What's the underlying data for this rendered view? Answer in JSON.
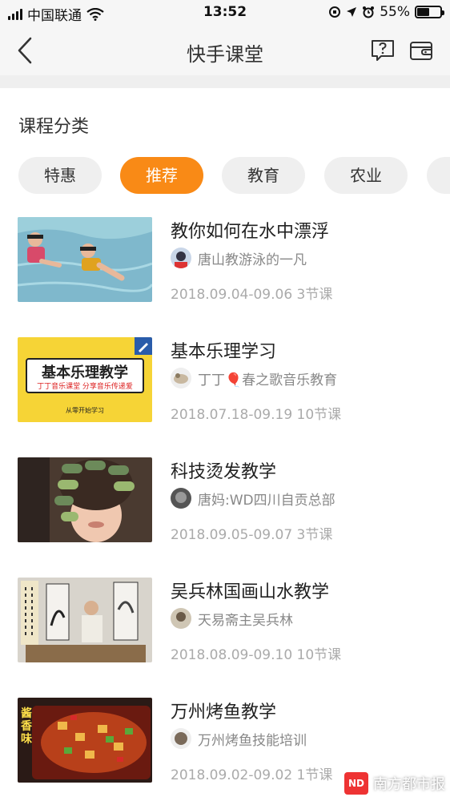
{
  "status_bar": {
    "carrier": "中国联通",
    "time": "13:52",
    "battery_text": "55%",
    "battery_level": 0.55
  },
  "nav": {
    "title": "快手课堂",
    "back_icon": "chevron-left-icon",
    "help_icon": "question-icon",
    "wallet_icon": "wallet-icon"
  },
  "section": {
    "title": "课程分类"
  },
  "categories": [
    {
      "label": "特惠",
      "active": false
    },
    {
      "label": "推荐",
      "active": true
    },
    {
      "label": "教育",
      "active": false
    },
    {
      "label": "农业",
      "active": false
    },
    {
      "label": "",
      "active": false
    }
  ],
  "courses": [
    {
      "title": "教你如何在水中漂浮",
      "teacher": "唐山教游泳的一凡",
      "meta": "2018.09.04-09.06 3节课"
    },
    {
      "title": "基本乐理学习",
      "teacher": "丁丁🎈春之歌音乐教育",
      "meta": "2018.07.18-09.19 10节课",
      "thumb_text": {
        "heading": "基本乐理教学",
        "sub": "丁丁音乐课堂 分享音乐传递爱",
        "foot": "从零开始学习"
      }
    },
    {
      "title": "科技烫发教学",
      "teacher": "唐妈:WD四川自贡总部",
      "meta": "2018.09.05-09.07 3节课"
    },
    {
      "title": "吴兵林国画山水教学",
      "teacher": "天易斋主吴兵林",
      "meta": "2018.08.09-09.10 10节课"
    },
    {
      "title": "万州烤鱼教学",
      "teacher": "万州烤鱼技能培训",
      "meta": "2018.09.02-09.02 1节课",
      "thumb_text": {
        "badge": "酱香味"
      }
    }
  ],
  "watermark": {
    "text": "南方都市报",
    "logo": "ND"
  },
  "colors": {
    "accent": "#f98a16",
    "chip_bg": "#efefef",
    "nav_bg": "#f6f6f6"
  }
}
